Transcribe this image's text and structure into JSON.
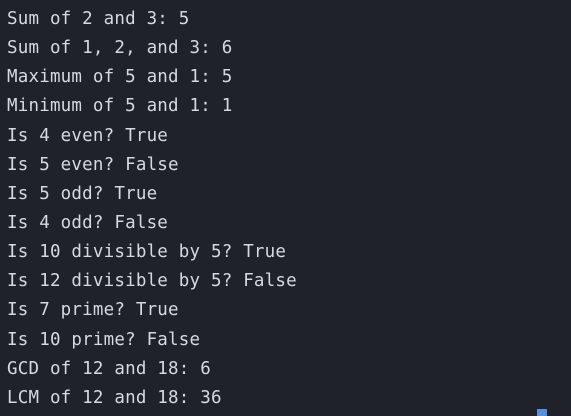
{
  "terminal": {
    "lines": [
      "Sum of 2 and 3: 5",
      "Sum of 1, 2, and 3: 6",
      "Maximum of 5 and 1: 5",
      "Minimum of 5 and 1: 1",
      "Is 4 even? True",
      "Is 5 even? False",
      "Is 5 odd? True",
      "Is 4 odd? False",
      "Is 10 divisible by 5? True",
      "Is 12 divisible by 5? False",
      "Is 7 prime? True",
      "Is 10 prime? False",
      "GCD of 12 and 18: 6",
      "LCM of 12 and 18: 36"
    ]
  }
}
